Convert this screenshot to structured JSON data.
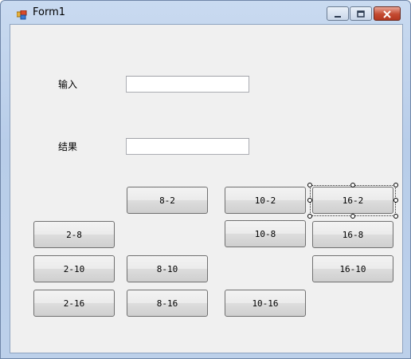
{
  "window": {
    "title": "Form1"
  },
  "form": {
    "input_label": "输入",
    "input_value": "",
    "result_label": "结果",
    "result_value": ""
  },
  "buttons": {
    "b8_2": "8-2",
    "b10_2": "10-2",
    "b16_2": "16-2",
    "b2_8": "2-8",
    "b10_8": "10-8",
    "b16_8": "16-8",
    "b2_10": "2-10",
    "b8_10": "8-10",
    "b16_10": "16-10",
    "b2_16": "2-16",
    "b8_16": "8-16",
    "b10_16": "10-16"
  },
  "selected_control": "16-2",
  "icons": {
    "app": "form-app-icon",
    "minimize": "minimize-icon",
    "maximize": "maximize-icon",
    "close": "close-icon"
  }
}
